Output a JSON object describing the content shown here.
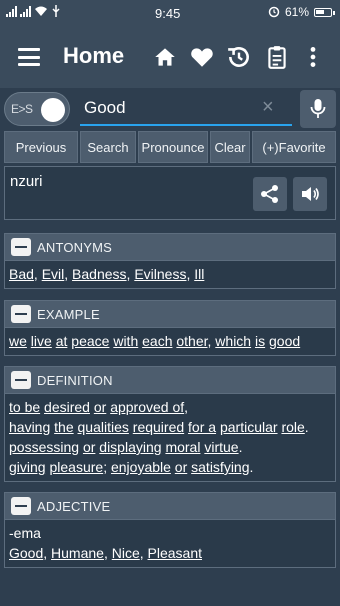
{
  "status": {
    "time": "9:45",
    "battery": "61%",
    "battery_level": 0.61
  },
  "appbar": {
    "title": "Home"
  },
  "search": {
    "toggle_label": "E>S",
    "value": "Good",
    "clear_icon": "×"
  },
  "actions": [
    "Previous",
    "Search",
    "Pronounce",
    "Clear",
    "(+)Favorite"
  ],
  "result": {
    "word": "nzuri"
  },
  "sections": {
    "antonyms": {
      "title": "ANTONYMS",
      "line1": {
        "w1": "Bad",
        "w2": "Evil",
        "w3": "Badness",
        "w4": "Evilness",
        "w5": "Ill"
      }
    },
    "example": {
      "title": "EXAMPLE",
      "words": [
        "we",
        "live",
        "at",
        "peace",
        "with",
        "each",
        "other",
        "which",
        "is",
        "good"
      ]
    },
    "definition": {
      "title": "DEFINITION",
      "l1": {
        "a": "to be",
        "b": "desired",
        "c": "or",
        "d": "approved of",
        "e": ","
      },
      "l2": {
        "a": "having",
        "b": "the",
        "c": "qualities",
        "d": "required",
        "e": "for a",
        "f": "particular",
        "g": "role",
        "h": "."
      },
      "l3": {
        "a": "possessing",
        "b": "or",
        "c": "displaying",
        "d": "moral",
        "e": "virtue",
        "f": "."
      },
      "l4": {
        "a": "giving",
        "b": "pleasure",
        "c": ";",
        "d": "enjoyable",
        "e": "or",
        "f": "satisfying",
        "g": "."
      }
    },
    "adjective": {
      "title": "ADJECTIVE",
      "translation": "-ema",
      "synonyms": [
        "Good",
        "Humane",
        "Nice",
        "Pleasant"
      ]
    }
  },
  "colors": {
    "background": "#2e3e4f",
    "bar": "#3a4b5c",
    "button": "#4d5d6e",
    "accent": "#29a3ee"
  }
}
